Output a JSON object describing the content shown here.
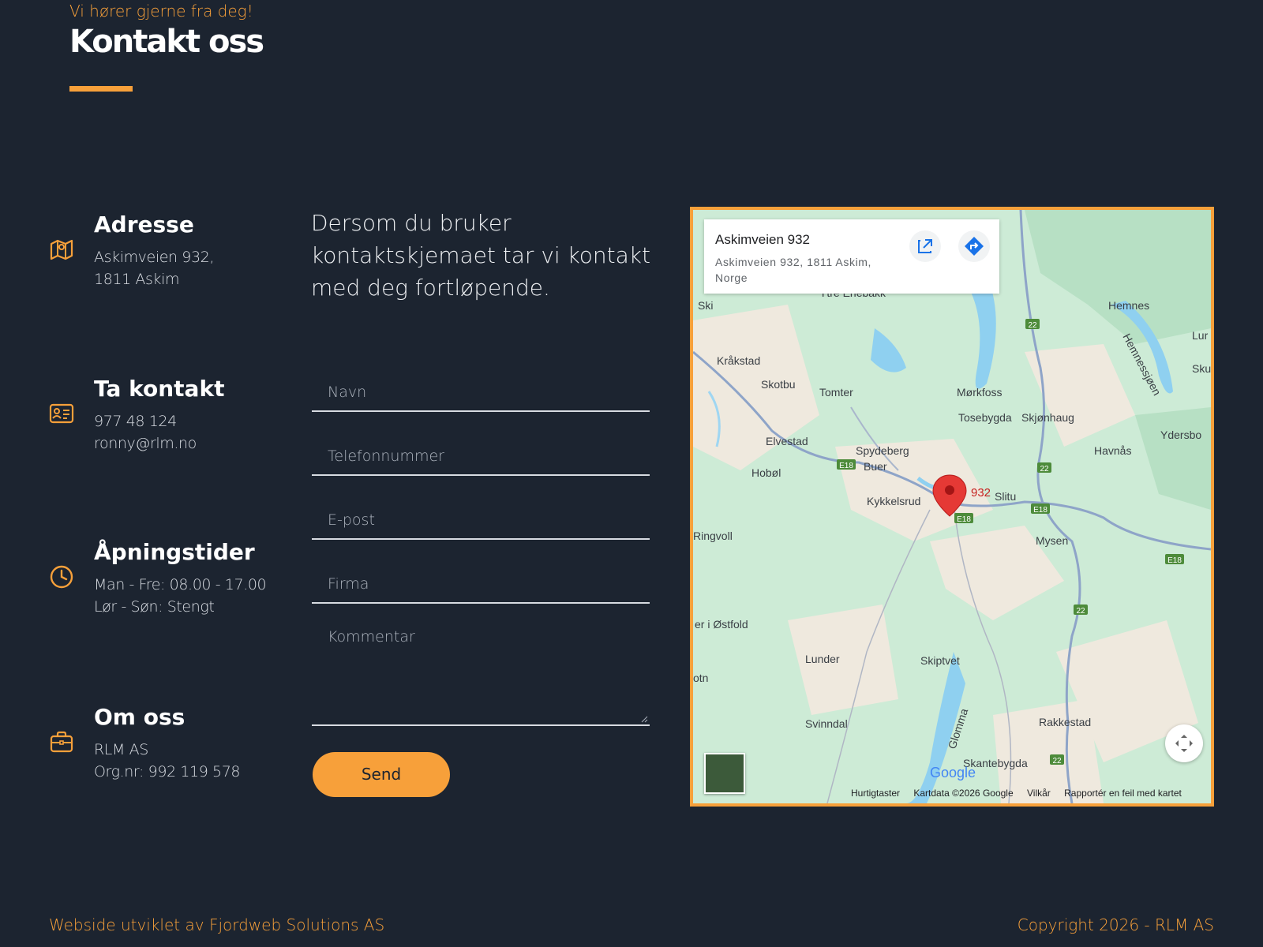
{
  "header": {
    "eyebrow": "Vi hører gjerne fra deg!",
    "title": "Kontakt oss"
  },
  "info": {
    "address": {
      "title": "Adresse",
      "lines": [
        "Askimveien 932,",
        "1811 Askim"
      ],
      "icon": "map-icon"
    },
    "contact": {
      "title": "Ta kontakt",
      "lines": [
        "977 48 124",
        "ronny@rlm.no"
      ],
      "icon": "contact-card-icon"
    },
    "hours": {
      "title": "Åpningstider",
      "lines": [
        "Man - Fre: 08.00 - 17.00",
        "Lør - Søn: Stengt"
      ],
      "icon": "clock-icon"
    },
    "about": {
      "title": "Om oss",
      "lines": [
        "RLM AS",
        "Org.nr: 992 119 578"
      ],
      "icon": "briefcase-icon"
    }
  },
  "intro": "Dersom du bruker kontaktskjemaet tar vi kontakt med deg fortløpende.",
  "form": {
    "name_placeholder": "Navn",
    "phone_placeholder": "Telefonnummer",
    "email_placeholder": "E-post",
    "company_placeholder": "Firma",
    "comment_placeholder": "Kommentar",
    "send_label": "Send"
  },
  "map": {
    "place_title": "Askimveien 932",
    "place_address": "Askimveien 932, 1811 Askim, Norge",
    "pin_label": "932",
    "places": [
      "Hemnes",
      "Lur",
      "Sku",
      "Ydersbo",
      "Ski",
      "Kråkstad",
      "Skotbu",
      "Tomter",
      "Mørkfoss",
      "Tosebygda",
      "Skjønhaug",
      "Elvestad",
      "Spydeberg",
      "Buer",
      "Hobøl",
      "Havnås",
      "Slitu",
      "Kykkelsrud",
      "Ringvoll",
      "Mysen",
      "er i Østfold",
      "Lunder",
      "Skiptvet",
      "otn",
      "Svinndal",
      "Glomma",
      "Rakkestad",
      "Skantebygda",
      "Hemnessjøen",
      "Ytre Enebakk"
    ],
    "road_labels": [
      "E18",
      "22"
    ],
    "google_logo": "Google",
    "attribution": [
      "Hurtigtaster",
      "Kartdata ©2026 Google",
      "Vilkår",
      "Rapportér en feil med kartet"
    ],
    "accent": "#f7a03a"
  },
  "footer": {
    "left": "Webside utviklet av Fjordweb Solutions AS",
    "right": "Copyright 2026 - RLM AS"
  }
}
